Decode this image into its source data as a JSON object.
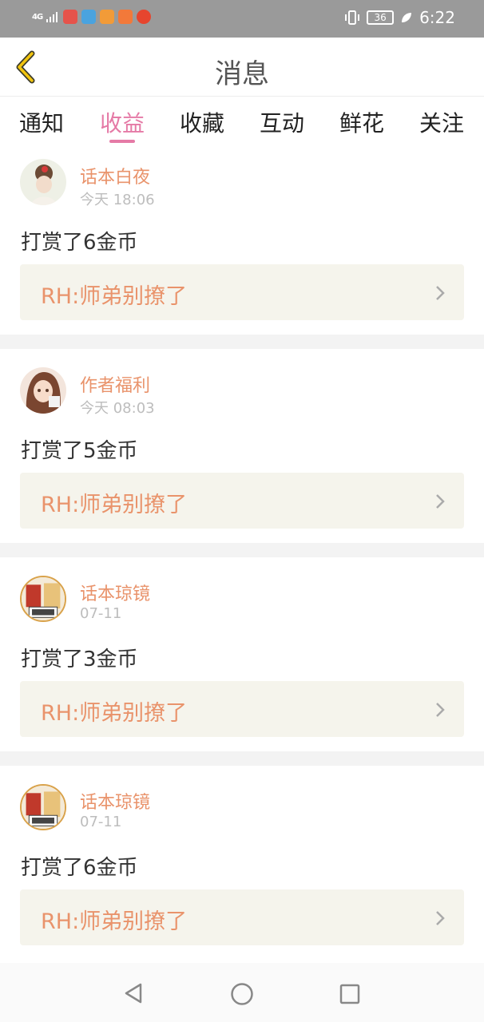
{
  "status_bar": {
    "network": "4G",
    "time": "6:22",
    "battery": "36",
    "app_icon_colors": [
      "#e5534b",
      "#4aa3df",
      "#f29b38",
      "#f2793a",
      "#e6452e"
    ]
  },
  "header": {
    "title": "消息",
    "back_icon": "chevron-left-icon"
  },
  "tabs": [
    {
      "label": "通知"
    },
    {
      "label": "收益",
      "active": true
    },
    {
      "label": "收藏"
    },
    {
      "label": "互动"
    },
    {
      "label": "鲜花"
    },
    {
      "label": "关注"
    }
  ],
  "messages": [
    {
      "user": "话本白夜",
      "time": "今天 18:06",
      "reward": "打赏了6金币",
      "ref": "RH:师弟别撩了"
    },
    {
      "user": "作者福利",
      "time": "今天 08:03",
      "reward": "打赏了5金币",
      "ref": "RH:师弟别撩了"
    },
    {
      "user": "话本琼镜",
      "time": "07-11",
      "reward": "打赏了3金币",
      "ref": "RH:师弟别撩了"
    },
    {
      "user": "话本琼镜",
      "time": "07-11",
      "reward": "打赏了6金币",
      "ref": "RH:师弟别撩了"
    }
  ],
  "colors": {
    "accent_pink": "#e57aa6",
    "name_orange": "#e9936b",
    "ref_bg": "#f5f4ec"
  },
  "nav_bar": {
    "back": "nav-back-icon",
    "home": "nav-home-icon",
    "recents": "nav-recents-icon"
  }
}
